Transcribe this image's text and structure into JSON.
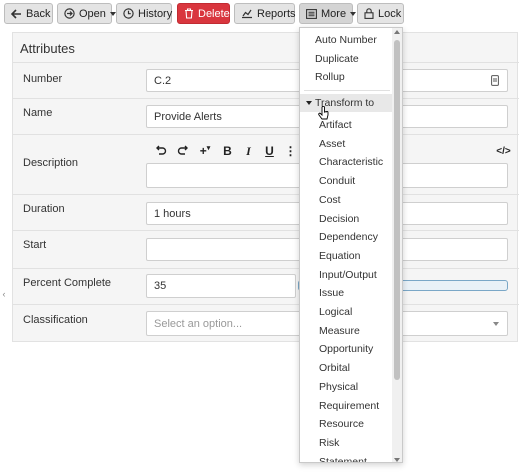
{
  "toolbar": {
    "back_label": "Back",
    "open_label": "Open",
    "history_label": "History",
    "delete_label": "Delete",
    "reports_label": "Reports",
    "more_label": "More",
    "lock_label": "Lock",
    "delete_color": "#d9363e"
  },
  "panel": {
    "title": "Attributes",
    "number_label": "Number",
    "number_value": "C.2",
    "name_label": "Name",
    "name_value": "Provide Alerts",
    "description_label": "Description",
    "description_value": "",
    "duration_label": "Duration",
    "duration_value": "1 hours",
    "start_label": "Start",
    "start_value": "",
    "percent_label": "Percent Complete",
    "percent_value": "35",
    "classification_label": "Classification",
    "classification_placeholder": "Select an option..."
  },
  "rte_icons": [
    "undo-icon",
    "redo-icon",
    "insert-icon",
    "bold-icon",
    "italic-icon",
    "underline-icon",
    "more-options-icon",
    "code-view-icon"
  ],
  "more_menu": {
    "top_items": [
      "Auto Number",
      "Duplicate",
      "Rollup"
    ],
    "transform_header": "Transform to",
    "transform_items": [
      "Artifact",
      "Asset",
      "Characteristic",
      "Conduit",
      "Cost",
      "Decision",
      "Dependency",
      "Equation",
      "Input/Output",
      "Issue",
      "Logical",
      "Measure",
      "Opportunity",
      "Orbital",
      "Physical",
      "Requirement",
      "Resource",
      "Risk",
      "Statement"
    ]
  }
}
